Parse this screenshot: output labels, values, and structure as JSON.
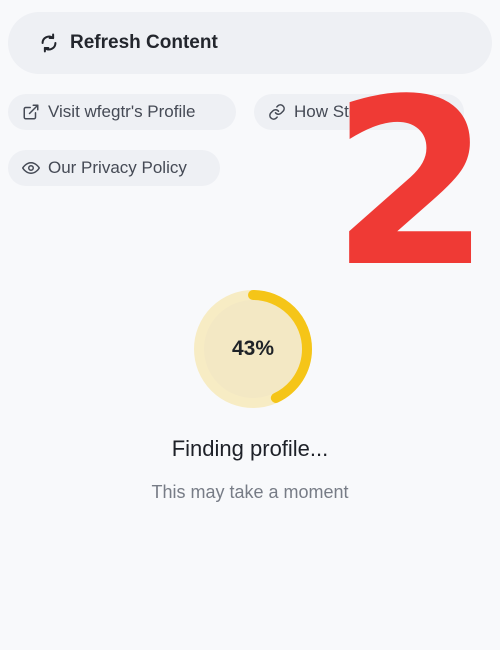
{
  "refresh": {
    "label": "Refresh Content",
    "icon": "refresh-icon"
  },
  "links": {
    "profile": {
      "label": "Visit wfegtr's Profile",
      "icon": "external-link-icon"
    },
    "how": {
      "label": "How Stories Work",
      "icon": "link-icon"
    },
    "privacy": {
      "label": "Our Privacy Policy",
      "icon": "eye-icon"
    }
  },
  "overlay": {
    "number": "2",
    "color": "#ef3a35"
  },
  "progress": {
    "value": 0.43,
    "label": "43%",
    "track_color": "#f7ecc4",
    "fill_color": "#f5c518"
  },
  "status": {
    "title": "Finding profile...",
    "subtitle": "This may take a moment"
  }
}
